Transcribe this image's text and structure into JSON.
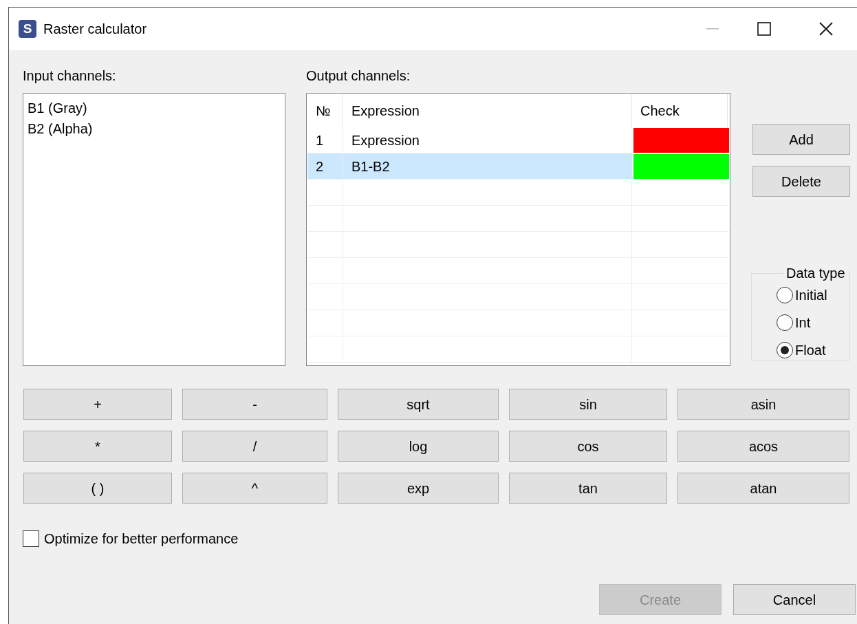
{
  "window": {
    "title": "Raster calculator",
    "icon_letter": "S"
  },
  "input_channels": {
    "label": "Input channels:",
    "items": [
      "B1 (Gray)",
      "B2 (Alpha)"
    ]
  },
  "output_channels": {
    "label": "Output channels:",
    "columns": [
      "№",
      "Expression",
      "Check"
    ],
    "rows": [
      {
        "number": "1",
        "expression": "Expression",
        "color": "#ff0000",
        "selected": false
      },
      {
        "number": "2",
        "expression": "B1-B2",
        "color": "#00ff00",
        "selected": true
      }
    ]
  },
  "side_buttons": [
    "Add",
    "Delete"
  ],
  "data_type": {
    "label": "Data type",
    "options": [
      {
        "label": "Initial",
        "selected": false
      },
      {
        "label": "Int",
        "selected": false
      },
      {
        "label": "Float",
        "selected": true
      }
    ]
  },
  "operators": [
    "+",
    "-",
    "sqrt",
    "sin",
    "asin",
    "*",
    "/",
    "log",
    "cos",
    "acos",
    "( )",
    "^",
    "exp",
    "tan",
    "atan"
  ],
  "optimize": {
    "label": "Optimize for better performance",
    "checked": false
  },
  "footer_buttons": [
    {
      "label": "Create",
      "disabled": true
    },
    {
      "label": "Cancel",
      "disabled": false
    }
  ]
}
